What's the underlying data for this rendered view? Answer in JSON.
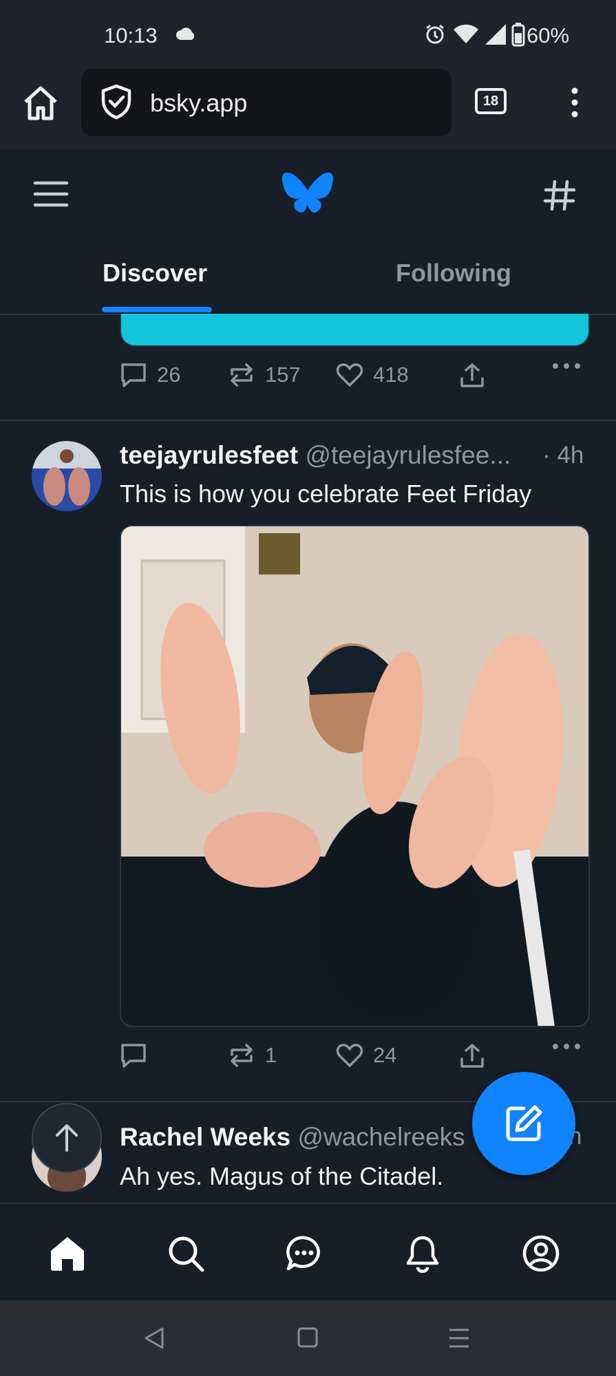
{
  "status_bar": {
    "time": "10:13",
    "battery": "60%",
    "icons": [
      "cloud-icon",
      "alarm-icon",
      "wifi-icon",
      "signal-icon",
      "battery-icon"
    ]
  },
  "browser": {
    "url": "bsky.app",
    "tab_count": "18"
  },
  "header": {
    "tabs": [
      {
        "label": "Discover",
        "active": true
      },
      {
        "label": "Following",
        "active": false
      }
    ]
  },
  "previous_post": {
    "replies": "26",
    "reposts": "157",
    "likes": "418"
  },
  "post": {
    "display_name": "teejayrulesfeet",
    "handle": "@teejayrulesfee...",
    "time": "· 4h",
    "text": "This is how you celebrate Feet Friday",
    "replies": "",
    "reposts": "1",
    "likes": "24"
  },
  "next_post": {
    "display_name": "Rachel Weeks",
    "handle": "@wachelreeks",
    "time_fragment": "h",
    "text": "Ah yes. Magus of the Citadel."
  },
  "colors": {
    "accent": "#1083fe",
    "background": "#161e27",
    "muted": "#8b98a5"
  }
}
